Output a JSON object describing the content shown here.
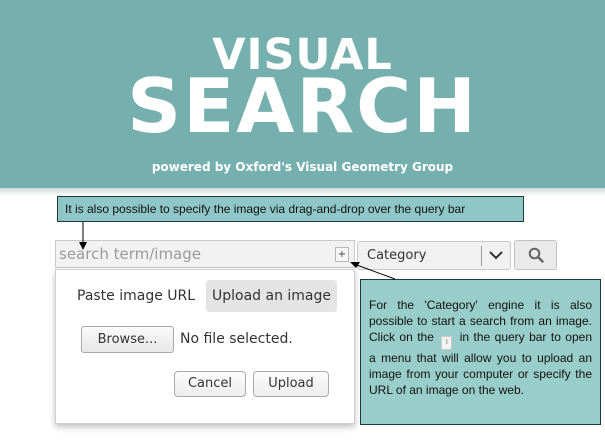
{
  "banner": {
    "title_line1": "VISUAL",
    "title_line2": "SEARCH",
    "subtitle": "powered by Oxford's Visual Geometry Group",
    "bg_color": "#76b0ae"
  },
  "tooltips": {
    "top": "It is also possible to specify the image via drag-and-drop over the query bar",
    "right_before": "For the 'Category' engine it is also possible to start a search from an image. Click on the",
    "right_after": "in the query bar to open a menu that will allow you to upload an image from your computer or specify the URL of an image on the web.",
    "bg_color": "#98cdca"
  },
  "search": {
    "placeholder": "search term/image",
    "plus_label": "+",
    "plus_icon": "plus-icon",
    "engine_selected": "Category",
    "engine_icon": "chevron-down-icon",
    "search_icon": "search-icon"
  },
  "upload_menu": {
    "paste_label": "Paste image URL",
    "upload_tab_label": "Upload an image",
    "browse_label": "Browse...",
    "no_file_text": "No file selected.",
    "cancel_label": "Cancel",
    "upload_label": "Upload"
  }
}
